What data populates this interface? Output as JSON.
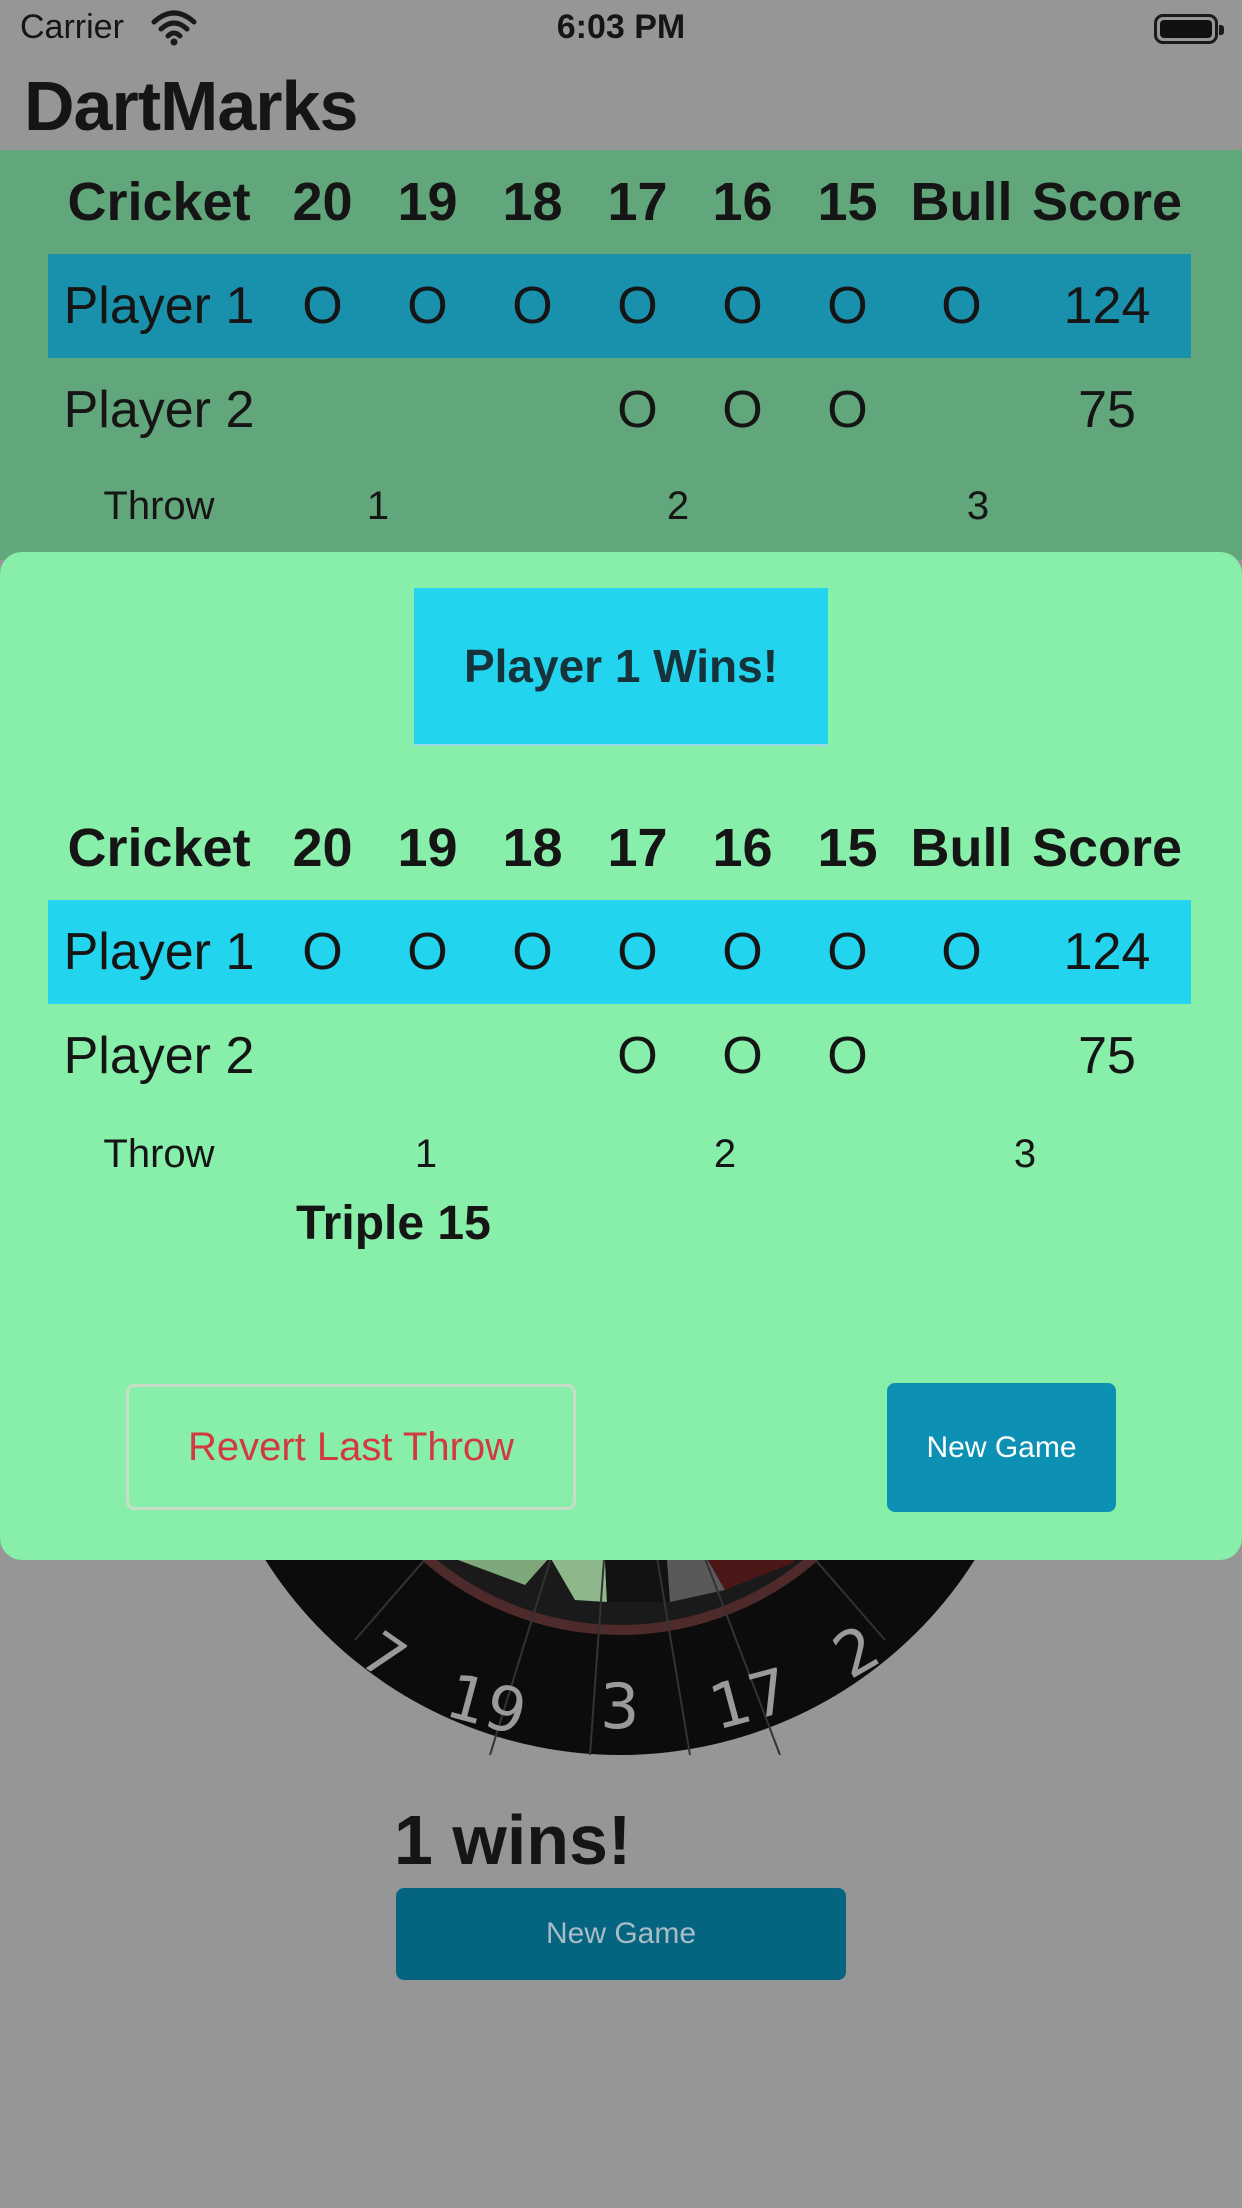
{
  "status_bar": {
    "carrier": "Carrier",
    "time": "6:03 PM"
  },
  "app": {
    "title": "DartMarks"
  },
  "board": {
    "headers": [
      "Cricket",
      "20",
      "19",
      "18",
      "17",
      "16",
      "15",
      "Bull",
      "Score"
    ],
    "players": [
      {
        "name": "Player 1",
        "marks": [
          "O",
          "O",
          "O",
          "O",
          "O",
          "O",
          "O"
        ],
        "score": "124",
        "active": true
      },
      {
        "name": "Player 2",
        "marks": [
          "",
          "",
          "",
          "O",
          "O",
          "O",
          ""
        ],
        "score": "75",
        "active": false
      }
    ],
    "throw": {
      "label": "Throw",
      "slots": [
        "1",
        "2",
        "3"
      ]
    }
  },
  "dartboard": {
    "visible_numbers": [
      "7",
      "19",
      "3",
      "17",
      "2"
    ]
  },
  "background": {
    "wins_text": "1 wins!",
    "new_game_label": "New Game"
  },
  "modal": {
    "winner_label": "Player 1 Wins!",
    "last_throw": "Triple 15",
    "revert_label": "Revert Last Throw",
    "new_game_label": "New Game"
  },
  "colors": {
    "background": "#969696",
    "board_background": "#62a77b",
    "board_active_row": "#1a91ac",
    "modal_background": "#87efaa",
    "modal_active_row": "#23d4ef",
    "revert_text": "#d23a3f",
    "new_game_button": "#0c91b5",
    "background_new_game": "#05647f"
  }
}
